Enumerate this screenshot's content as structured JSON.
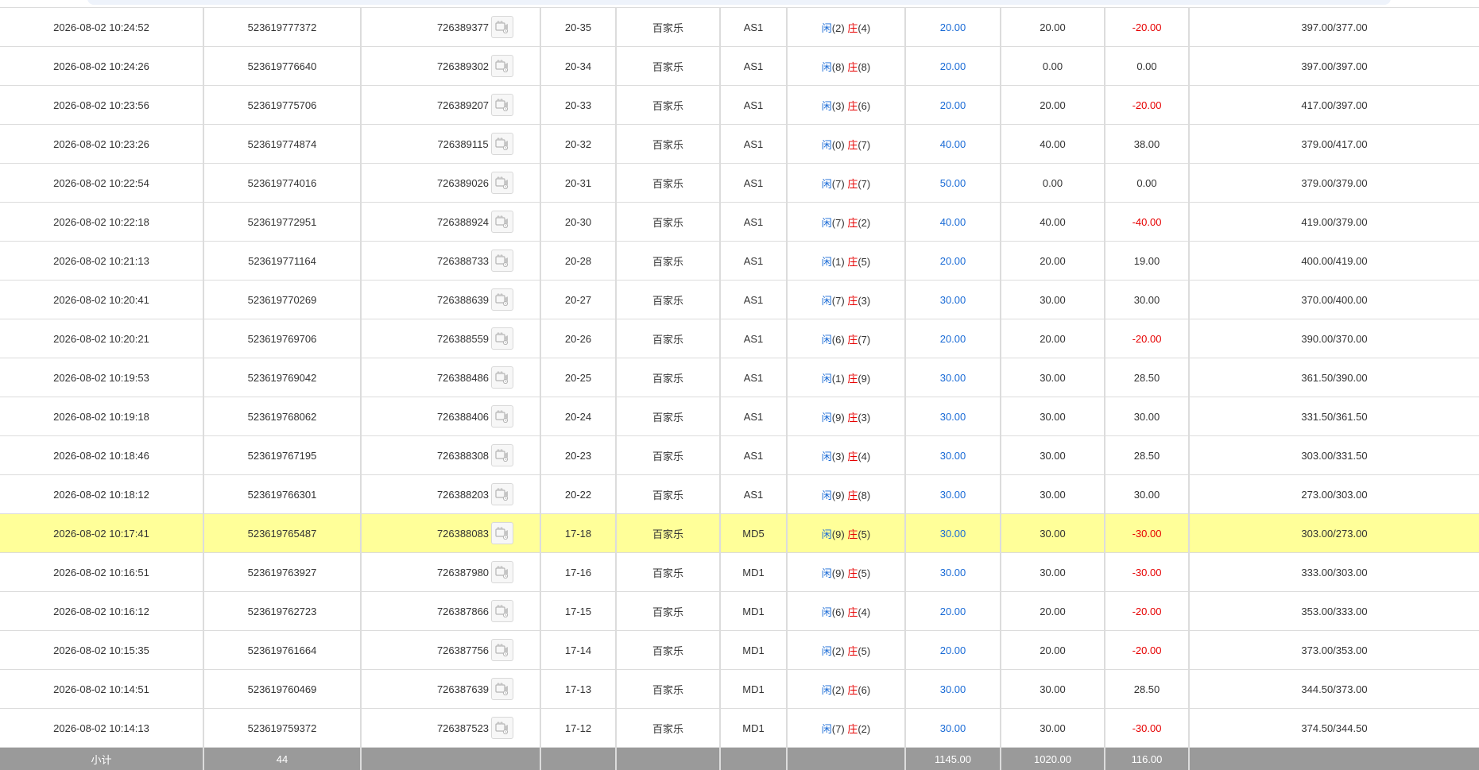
{
  "rows": [
    {
      "time": "2026-08-02 10:24:52",
      "order_no": "523619777372",
      "round_no": "726389377",
      "shoe": "20-35",
      "game": "百家乐",
      "table": "AS1",
      "player_label": "闲",
      "player_val": "(2)",
      "banker_label": "庄",
      "banker_val": "(4)",
      "bet": "20.00",
      "valid": "20.00",
      "win": "-20.00",
      "win_neg": true,
      "balance": "397.00/377.00"
    },
    {
      "time": "2026-08-02 10:24:26",
      "order_no": "523619776640",
      "round_no": "726389302",
      "shoe": "20-34",
      "game": "百家乐",
      "table": "AS1",
      "player_label": "闲",
      "player_val": "(8)",
      "banker_label": "庄",
      "banker_val": "(8)",
      "bet": "20.00",
      "valid": "0.00",
      "win": "0.00",
      "win_neg": false,
      "balance": "397.00/397.00"
    },
    {
      "time": "2026-08-02 10:23:56",
      "order_no": "523619775706",
      "round_no": "726389207",
      "shoe": "20-33",
      "game": "百家乐",
      "table": "AS1",
      "player_label": "闲",
      "player_val": "(3)",
      "banker_label": "庄",
      "banker_val": "(6)",
      "bet": "20.00",
      "valid": "20.00",
      "win": "-20.00",
      "win_neg": true,
      "balance": "417.00/397.00"
    },
    {
      "time": "2026-08-02 10:23:26",
      "order_no": "523619774874",
      "round_no": "726389115",
      "shoe": "20-32",
      "game": "百家乐",
      "table": "AS1",
      "player_label": "闲",
      "player_val": "(0)",
      "banker_label": "庄",
      "banker_val": "(7)",
      "bet": "40.00",
      "valid": "40.00",
      "win": "38.00",
      "win_neg": false,
      "balance": "379.00/417.00"
    },
    {
      "time": "2026-08-02 10:22:54",
      "order_no": "523619774016",
      "round_no": "726389026",
      "shoe": "20-31",
      "game": "百家乐",
      "table": "AS1",
      "player_label": "闲",
      "player_val": "(7)",
      "banker_label": "庄",
      "banker_val": "(7)",
      "bet": "50.00",
      "valid": "0.00",
      "win": "0.00",
      "win_neg": false,
      "balance": "379.00/379.00"
    },
    {
      "time": "2026-08-02 10:22:18",
      "order_no": "523619772951",
      "round_no": "726388924",
      "shoe": "20-30",
      "game": "百家乐",
      "table": "AS1",
      "player_label": "闲",
      "player_val": "(7)",
      "banker_label": "庄",
      "banker_val": "(2)",
      "bet": "40.00",
      "valid": "40.00",
      "win": "-40.00",
      "win_neg": true,
      "balance": "419.00/379.00"
    },
    {
      "time": "2026-08-02 10:21:13",
      "order_no": "523619771164",
      "round_no": "726388733",
      "shoe": "20-28",
      "game": "百家乐",
      "table": "AS1",
      "player_label": "闲",
      "player_val": "(1)",
      "banker_label": "庄",
      "banker_val": "(5)",
      "bet": "20.00",
      "valid": "20.00",
      "win": "19.00",
      "win_neg": false,
      "balance": "400.00/419.00"
    },
    {
      "time": "2026-08-02 10:20:41",
      "order_no": "523619770269",
      "round_no": "726388639",
      "shoe": "20-27",
      "game": "百家乐",
      "table": "AS1",
      "player_label": "闲",
      "player_val": "(7)",
      "banker_label": "庄",
      "banker_val": "(3)",
      "bet": "30.00",
      "valid": "30.00",
      "win": "30.00",
      "win_neg": false,
      "balance": "370.00/400.00"
    },
    {
      "time": "2026-08-02 10:20:21",
      "order_no": "523619769706",
      "round_no": "726388559",
      "shoe": "20-26",
      "game": "百家乐",
      "table": "AS1",
      "player_label": "闲",
      "player_val": "(6)",
      "banker_label": "庄",
      "banker_val": "(7)",
      "bet": "20.00",
      "valid": "20.00",
      "win": "-20.00",
      "win_neg": true,
      "balance": "390.00/370.00"
    },
    {
      "time": "2026-08-02 10:19:53",
      "order_no": "523619769042",
      "round_no": "726388486",
      "shoe": "20-25",
      "game": "百家乐",
      "table": "AS1",
      "player_label": "闲",
      "player_val": "(1)",
      "banker_label": "庄",
      "banker_val": "(9)",
      "bet": "30.00",
      "valid": "30.00",
      "win": "28.50",
      "win_neg": false,
      "balance": "361.50/390.00"
    },
    {
      "time": "2026-08-02 10:19:18",
      "order_no": "523619768062",
      "round_no": "726388406",
      "shoe": "20-24",
      "game": "百家乐",
      "table": "AS1",
      "player_label": "闲",
      "player_val": "(9)",
      "banker_label": "庄",
      "banker_val": "(3)",
      "bet": "30.00",
      "valid": "30.00",
      "win": "30.00",
      "win_neg": false,
      "balance": "331.50/361.50"
    },
    {
      "time": "2026-08-02 10:18:46",
      "order_no": "523619767195",
      "round_no": "726388308",
      "shoe": "20-23",
      "game": "百家乐",
      "table": "AS1",
      "player_label": "闲",
      "player_val": "(3)",
      "banker_label": "庄",
      "banker_val": "(4)",
      "bet": "30.00",
      "valid": "30.00",
      "win": "28.50",
      "win_neg": false,
      "balance": "303.00/331.50"
    },
    {
      "time": "2026-08-02 10:18:12",
      "order_no": "523619766301",
      "round_no": "726388203",
      "shoe": "20-22",
      "game": "百家乐",
      "table": "AS1",
      "player_label": "闲",
      "player_val": "(9)",
      "banker_label": "庄",
      "banker_val": "(8)",
      "bet": "30.00",
      "valid": "30.00",
      "win": "30.00",
      "win_neg": false,
      "balance": "273.00/303.00"
    },
    {
      "time": "2026-08-02 10:17:41",
      "order_no": "523619765487",
      "round_no": "726388083",
      "shoe": "17-18",
      "game": "百家乐",
      "table": "MD5",
      "player_label": "闲",
      "player_val": "(9)",
      "banker_label": "庄",
      "banker_val": "(5)",
      "bet": "30.00",
      "valid": "30.00",
      "win": "-30.00",
      "win_neg": true,
      "balance": "303.00/273.00",
      "highlighted": true
    },
    {
      "time": "2026-08-02 10:16:51",
      "order_no": "523619763927",
      "round_no": "726387980",
      "shoe": "17-16",
      "game": "百家乐",
      "table": "MD1",
      "player_label": "闲",
      "player_val": "(9)",
      "banker_label": "庄",
      "banker_val": "(5)",
      "bet": "30.00",
      "valid": "30.00",
      "win": "-30.00",
      "win_neg": true,
      "balance": "333.00/303.00"
    },
    {
      "time": "2026-08-02 10:16:12",
      "order_no": "523619762723",
      "round_no": "726387866",
      "shoe": "17-15",
      "game": "百家乐",
      "table": "MD1",
      "player_label": "闲",
      "player_val": "(6)",
      "banker_label": "庄",
      "banker_val": "(4)",
      "bet": "20.00",
      "valid": "20.00",
      "win": "-20.00",
      "win_neg": true,
      "balance": "353.00/333.00"
    },
    {
      "time": "2026-08-02 10:15:35",
      "order_no": "523619761664",
      "round_no": "726387756",
      "shoe": "17-14",
      "game": "百家乐",
      "table": "MD1",
      "player_label": "闲",
      "player_val": "(2)",
      "banker_label": "庄",
      "banker_val": "(5)",
      "bet": "20.00",
      "valid": "20.00",
      "win": "-20.00",
      "win_neg": true,
      "balance": "373.00/353.00"
    },
    {
      "time": "2026-08-02 10:14:51",
      "order_no": "523619760469",
      "round_no": "726387639",
      "shoe": "17-13",
      "game": "百家乐",
      "table": "MD1",
      "player_label": "闲",
      "player_val": "(2)",
      "banker_label": "庄",
      "banker_val": "(6)",
      "bet": "30.00",
      "valid": "30.00",
      "win": "28.50",
      "win_neg": false,
      "balance": "344.50/373.00"
    },
    {
      "time": "2026-08-02 10:14:13",
      "order_no": "523619759372",
      "round_no": "726387523",
      "shoe": "17-12",
      "game": "百家乐",
      "table": "MD1",
      "player_label": "闲",
      "player_val": "(7)",
      "banker_label": "庄",
      "banker_val": "(2)",
      "bet": "30.00",
      "valid": "30.00",
      "win": "-30.00",
      "win_neg": true,
      "balance": "374.50/344.50"
    }
  ],
  "subtotal": {
    "label": "小计",
    "count": "44",
    "bet": "1145.00",
    "valid": "1020.00",
    "win": "116.00"
  },
  "icons": {
    "replay": "video-replay-icon"
  },
  "colors": {
    "blue": "#1a6bd6",
    "red": "#e60000",
    "highlight_row": "#ffff99",
    "subtotal_bg": "#9a9a9a"
  }
}
